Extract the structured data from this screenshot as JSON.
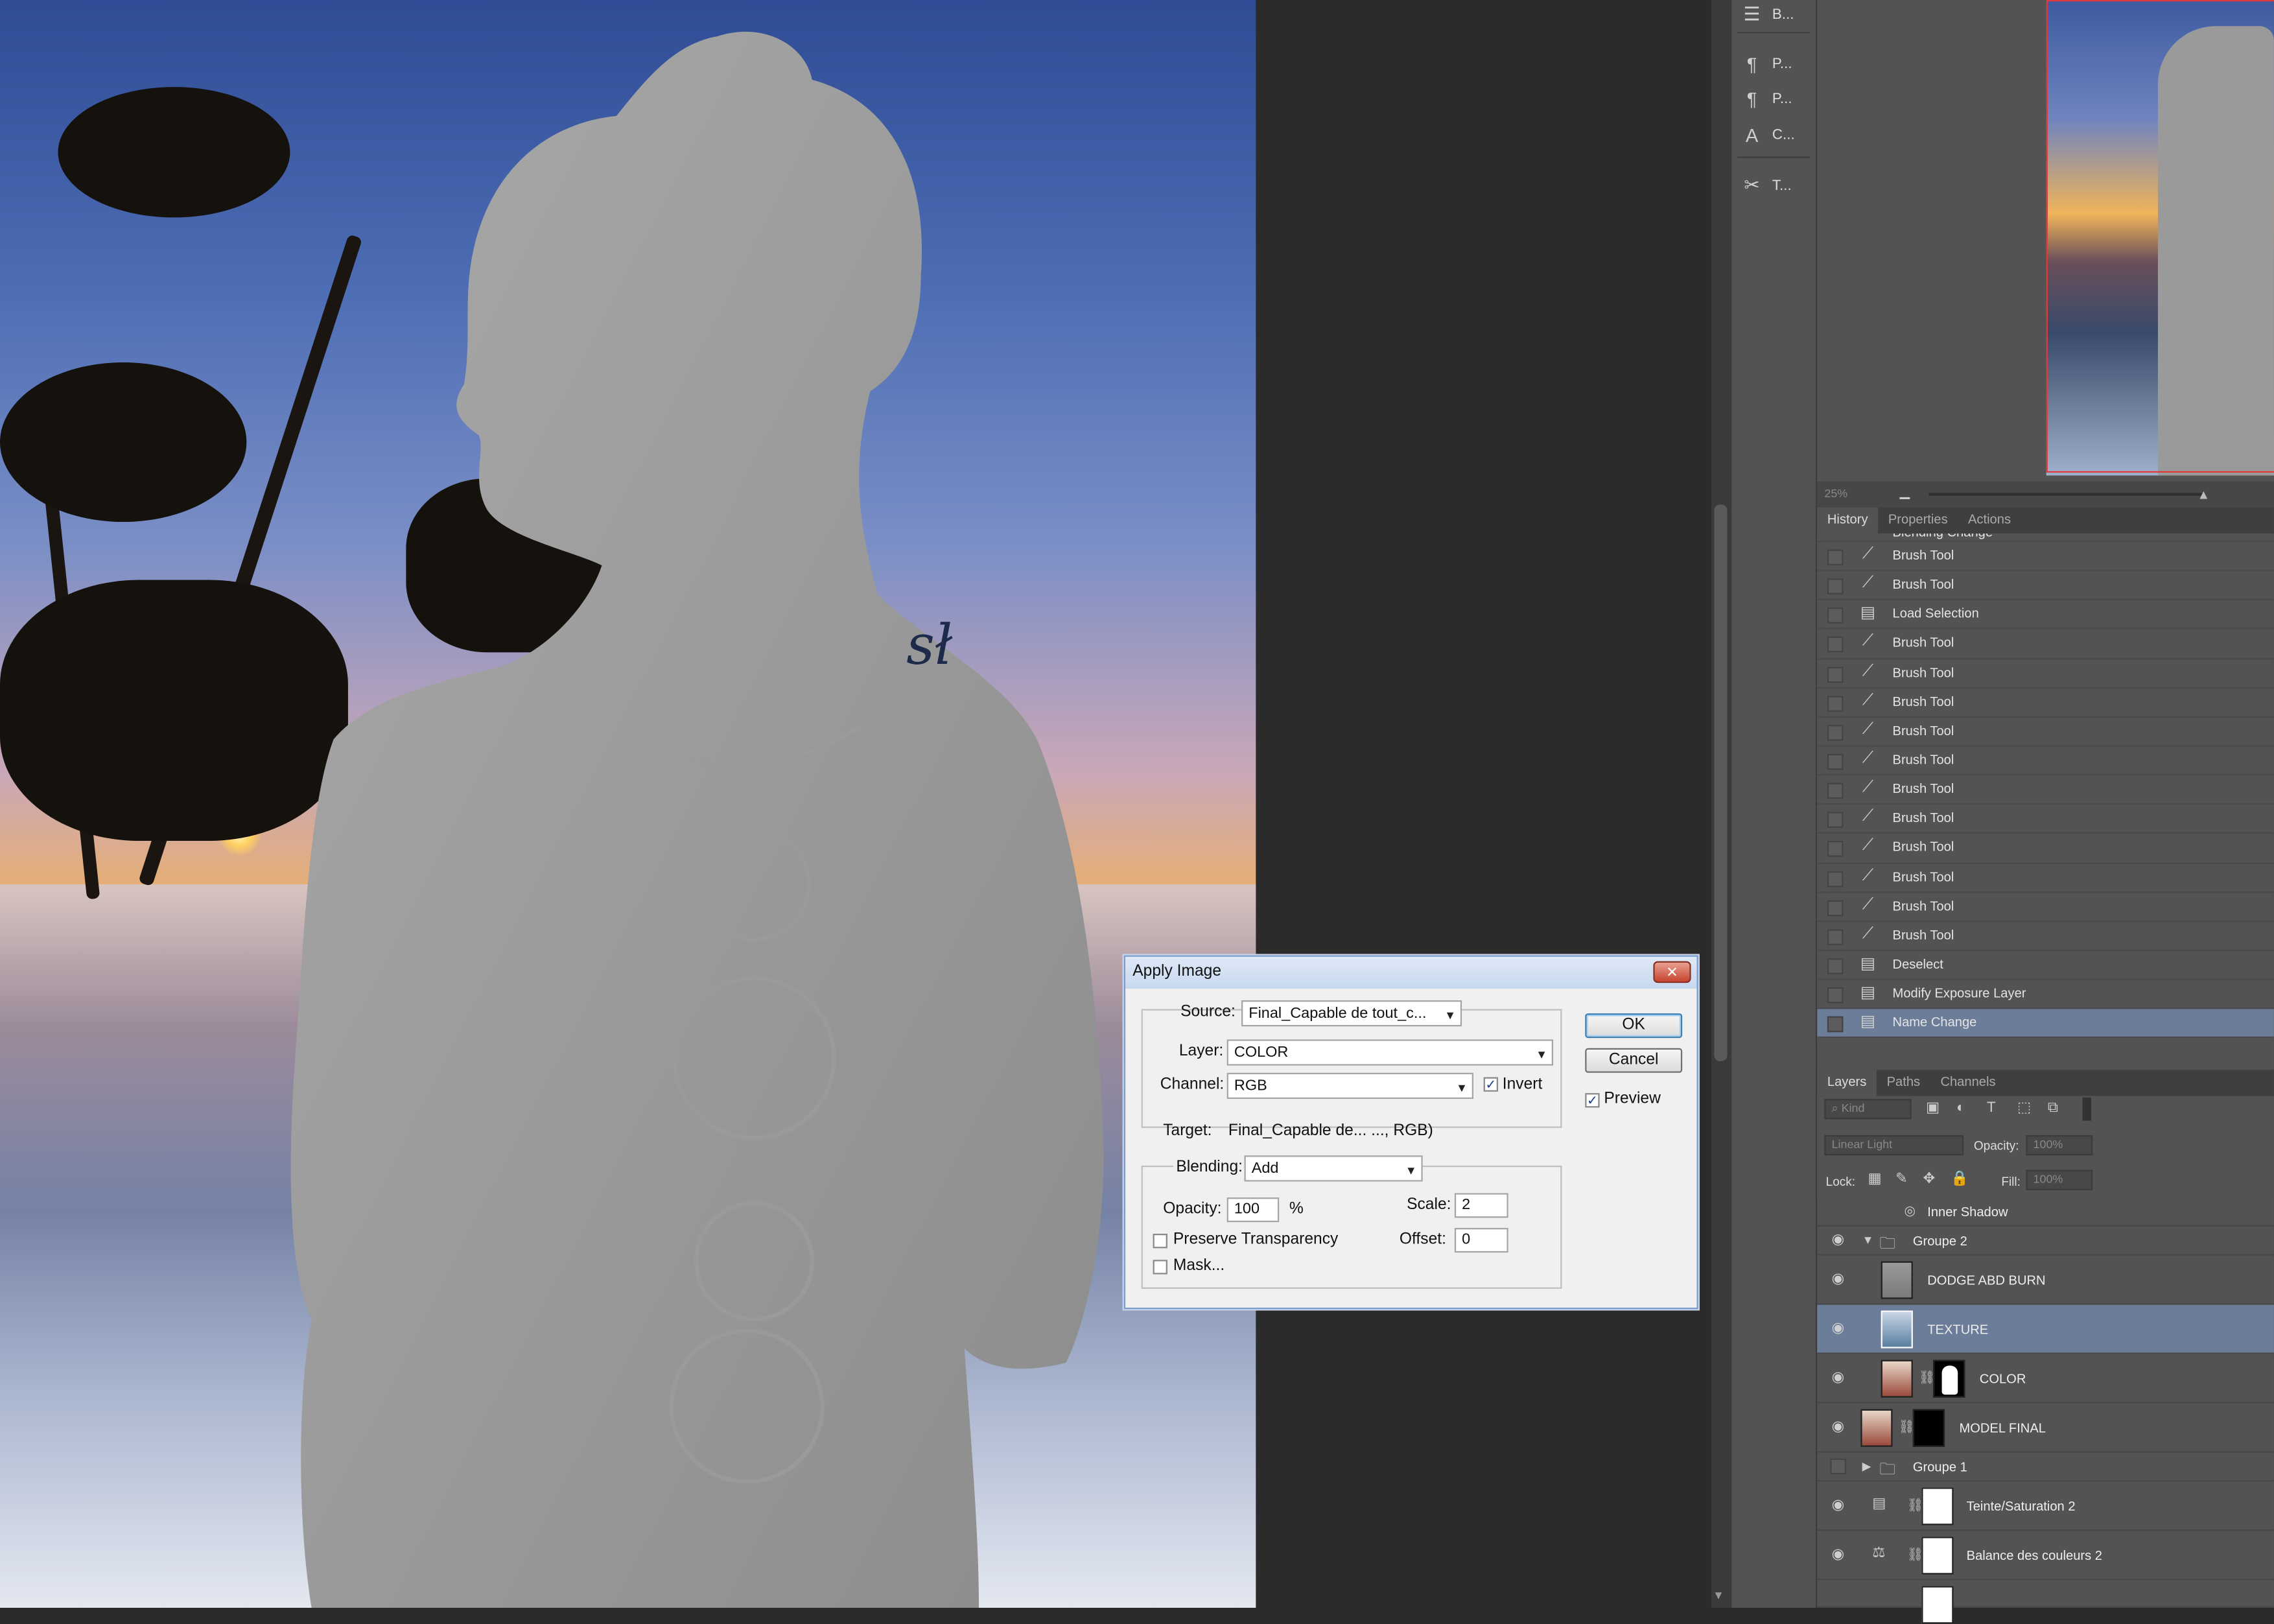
{
  "toolstrip": {
    "items": [
      {
        "icon": "adjust-sliders-icon",
        "label": "B..."
      },
      {
        "icon": "paragraph-icon",
        "label": "P..."
      },
      {
        "icon": "paragraph-styles-icon",
        "label": "P..."
      },
      {
        "icon": "character-styles-icon",
        "label": "C..."
      },
      {
        "icon": "tool-presets-icon",
        "label": "T..."
      }
    ]
  },
  "canvas": {
    "signature_text": "sł"
  },
  "navigator": {
    "zoom": "25%"
  },
  "panel_tabs_top": [
    "History",
    "Properties",
    "Actions"
  ],
  "history": {
    "partial_item": "Blending Change",
    "items": [
      {
        "label": "Brush Tool",
        "icon": "brush-icon"
      },
      {
        "label": "Brush Tool",
        "icon": "brush-icon"
      },
      {
        "label": "Load Selection",
        "icon": "document-icon"
      },
      {
        "label": "Brush Tool",
        "icon": "brush-icon"
      },
      {
        "label": "Brush Tool",
        "icon": "brush-icon"
      },
      {
        "label": "Brush Tool",
        "icon": "brush-icon"
      },
      {
        "label": "Brush Tool",
        "icon": "brush-icon"
      },
      {
        "label": "Brush Tool",
        "icon": "brush-icon"
      },
      {
        "label": "Brush Tool",
        "icon": "brush-icon"
      },
      {
        "label": "Brush Tool",
        "icon": "brush-icon"
      },
      {
        "label": "Brush Tool",
        "icon": "brush-icon"
      },
      {
        "label": "Brush Tool",
        "icon": "brush-icon"
      },
      {
        "label": "Brush Tool",
        "icon": "brush-icon"
      },
      {
        "label": "Brush Tool",
        "icon": "brush-icon"
      },
      {
        "label": "Deselect",
        "icon": "document-icon"
      },
      {
        "label": "Modify Exposure Layer",
        "icon": "document-icon"
      },
      {
        "label": "Name Change",
        "icon": "document-icon",
        "selected": true
      }
    ]
  },
  "panel_tabs_bottom": [
    "Layers",
    "Paths",
    "Channels"
  ],
  "layers": {
    "kind_label": "Kind",
    "blend_mode": "Linear Light",
    "opacity_label": "Opacity:",
    "opacity_value": "100%",
    "lock_label": "Lock:",
    "fill_label": "Fill:",
    "fill_value": "100%",
    "effect_row": "Inner Shadow",
    "rows": [
      {
        "name": "Groupe 2",
        "type": "group-open"
      },
      {
        "name": "DODGE ABD BURN",
        "type": "layer"
      },
      {
        "name": "TEXTURE",
        "type": "layer",
        "selected": true
      },
      {
        "name": "COLOR",
        "type": "layer-mask"
      },
      {
        "name": "MODEL FINAL",
        "type": "layer-mask"
      },
      {
        "name": "Groupe 1",
        "type": "group-closed"
      },
      {
        "name": "Teinte/Saturation 2",
        "type": "adjustment"
      },
      {
        "name": "Balance des couleurs 2",
        "type": "adjustment"
      }
    ]
  },
  "dialog": {
    "title": "Apply Image",
    "source_label": "Source:",
    "source_value": "Final_Capable de tout_c...",
    "layer_label": "Layer:",
    "layer_value": "COLOR",
    "channel_label": "Channel:",
    "channel_value": "RGB",
    "invert_label": "Invert",
    "invert_checked": true,
    "target_label": "Target:",
    "target_value": "Final_Capable de... ..., RGB)",
    "blending_label": "Blending:",
    "blending_value": "Add",
    "opacity_label": "Opacity:",
    "opacity_value": "100",
    "opacity_unit": "%",
    "scale_label": "Scale:",
    "scale_value": "2",
    "offset_label": "Offset:",
    "offset_value": "0",
    "preserve_label": "Preserve Transparency",
    "mask_label": "Mask...",
    "ok_label": "OK",
    "cancel_label": "Cancel",
    "preview_label": "Preview",
    "preview_checked": true
  },
  "colors": {
    "selection_blue": "#6b7d99",
    "panel_gray": "#535353",
    "navigator_frame": "#e03b3b"
  }
}
